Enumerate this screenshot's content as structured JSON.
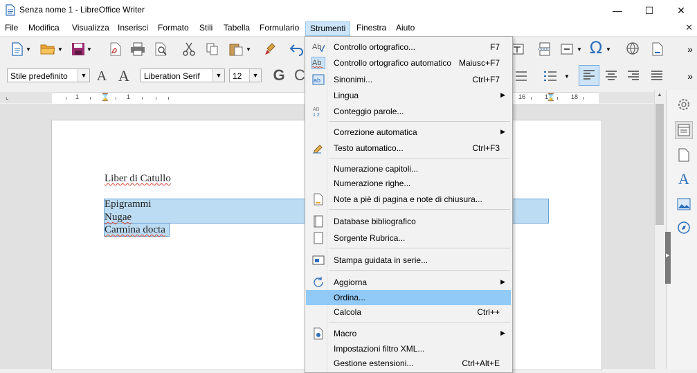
{
  "window": {
    "title": "Senza nome 1 - LibreOffice Writer"
  },
  "menubar": {
    "items": [
      {
        "label": "File"
      },
      {
        "label": "Modifica"
      },
      {
        "label": "Visualizza"
      },
      {
        "label": "Inserisci"
      },
      {
        "label": "Formato"
      },
      {
        "label": "Stili"
      },
      {
        "label": "Tabella"
      },
      {
        "label": "Formulario"
      },
      {
        "label": "Strumenti"
      },
      {
        "label": "Finestra"
      },
      {
        "label": "Aiuto"
      }
    ],
    "active": "Strumenti"
  },
  "formatting": {
    "paragraph_style": "Stile predefinito",
    "font_name": "Liberation Serif",
    "font_size": "12"
  },
  "ruler": {
    "numbers": [
      "1",
      "1",
      "16",
      "17",
      "18"
    ]
  },
  "document": {
    "heading": "Liber di Catullo",
    "lines": [
      "Epigrammi",
      "Nugae",
      "Carmina docta"
    ]
  },
  "dropdown": {
    "group1": [
      {
        "label": "Controllo ortografico...",
        "shortcut": "F7"
      },
      {
        "label": "Controllo ortografico automatico",
        "shortcut": "Maiusc+F7"
      },
      {
        "label": "Sinonimi...",
        "shortcut": "Ctrl+F7"
      },
      {
        "label": "Lingua",
        "shortcut": ""
      },
      {
        "label": "Conteggio parole...",
        "shortcut": ""
      }
    ],
    "group2": [
      {
        "label": "Correzione automatica",
        "shortcut": ""
      },
      {
        "label": "Testo automatico...",
        "shortcut": "Ctrl+F3"
      }
    ],
    "group3": [
      {
        "label": "Numerazione capitoli...",
        "shortcut": ""
      },
      {
        "label": "Numerazione righe...",
        "shortcut": ""
      },
      {
        "label": "Note a piè di pagina e note di chiusura...",
        "shortcut": ""
      }
    ],
    "group4": [
      {
        "label": "Database bibliografico",
        "shortcut": ""
      },
      {
        "label": "Sorgente Rubrica...",
        "shortcut": ""
      }
    ],
    "group5": [
      {
        "label": "Stampa guidata in serie...",
        "shortcut": ""
      }
    ],
    "group6": [
      {
        "label": "Aggiorna",
        "shortcut": ""
      },
      {
        "label": "Ordina...",
        "shortcut": ""
      },
      {
        "label": "Calcola",
        "shortcut": "Ctrl++"
      }
    ],
    "group7": [
      {
        "label": "Macro",
        "shortcut": ""
      },
      {
        "label": "Impostazioni filtro XML...",
        "shortcut": ""
      },
      {
        "label": "Gestione estensioni...",
        "shortcut": "Ctrl+Alt+E"
      }
    ],
    "highlighted": "Ordina..."
  },
  "colors": {
    "menu_highlight": "#91c9f7",
    "selection": "#bcdcf4",
    "accent": "#2a6ebb"
  }
}
